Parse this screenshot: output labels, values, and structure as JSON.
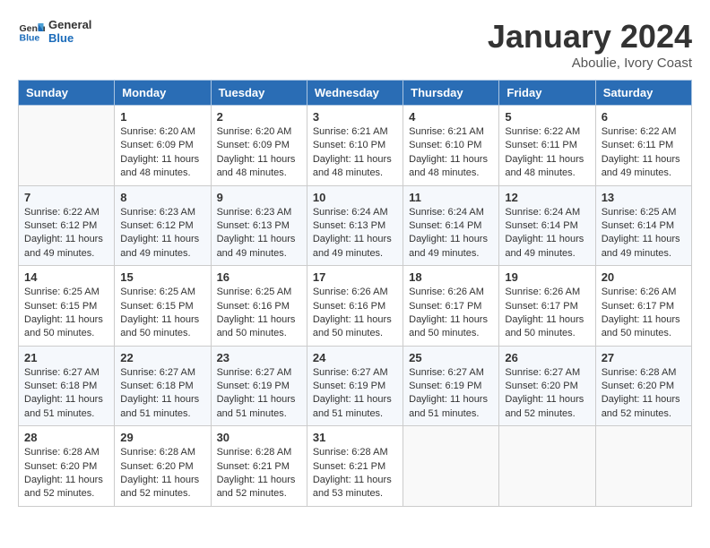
{
  "logo": {
    "line1": "General",
    "line2": "Blue"
  },
  "header": {
    "month": "January 2024",
    "location": "Aboulie, Ivory Coast"
  },
  "days_of_week": [
    "Sunday",
    "Monday",
    "Tuesday",
    "Wednesday",
    "Thursday",
    "Friday",
    "Saturday"
  ],
  "weeks": [
    [
      {
        "day": "",
        "sunrise": "",
        "sunset": "",
        "daylight": ""
      },
      {
        "day": "1",
        "sunrise": "Sunrise: 6:20 AM",
        "sunset": "Sunset: 6:09 PM",
        "daylight": "Daylight: 11 hours and 48 minutes."
      },
      {
        "day": "2",
        "sunrise": "Sunrise: 6:20 AM",
        "sunset": "Sunset: 6:09 PM",
        "daylight": "Daylight: 11 hours and 48 minutes."
      },
      {
        "day": "3",
        "sunrise": "Sunrise: 6:21 AM",
        "sunset": "Sunset: 6:10 PM",
        "daylight": "Daylight: 11 hours and 48 minutes."
      },
      {
        "day": "4",
        "sunrise": "Sunrise: 6:21 AM",
        "sunset": "Sunset: 6:10 PM",
        "daylight": "Daylight: 11 hours and 48 minutes."
      },
      {
        "day": "5",
        "sunrise": "Sunrise: 6:22 AM",
        "sunset": "Sunset: 6:11 PM",
        "daylight": "Daylight: 11 hours and 48 minutes."
      },
      {
        "day": "6",
        "sunrise": "Sunrise: 6:22 AM",
        "sunset": "Sunset: 6:11 PM",
        "daylight": "Daylight: 11 hours and 49 minutes."
      }
    ],
    [
      {
        "day": "7",
        "sunrise": "Sunrise: 6:22 AM",
        "sunset": "Sunset: 6:12 PM",
        "daylight": "Daylight: 11 hours and 49 minutes."
      },
      {
        "day": "8",
        "sunrise": "Sunrise: 6:23 AM",
        "sunset": "Sunset: 6:12 PM",
        "daylight": "Daylight: 11 hours and 49 minutes."
      },
      {
        "day": "9",
        "sunrise": "Sunrise: 6:23 AM",
        "sunset": "Sunset: 6:13 PM",
        "daylight": "Daylight: 11 hours and 49 minutes."
      },
      {
        "day": "10",
        "sunrise": "Sunrise: 6:24 AM",
        "sunset": "Sunset: 6:13 PM",
        "daylight": "Daylight: 11 hours and 49 minutes."
      },
      {
        "day": "11",
        "sunrise": "Sunrise: 6:24 AM",
        "sunset": "Sunset: 6:14 PM",
        "daylight": "Daylight: 11 hours and 49 minutes."
      },
      {
        "day": "12",
        "sunrise": "Sunrise: 6:24 AM",
        "sunset": "Sunset: 6:14 PM",
        "daylight": "Daylight: 11 hours and 49 minutes."
      },
      {
        "day": "13",
        "sunrise": "Sunrise: 6:25 AM",
        "sunset": "Sunset: 6:14 PM",
        "daylight": "Daylight: 11 hours and 49 minutes."
      }
    ],
    [
      {
        "day": "14",
        "sunrise": "Sunrise: 6:25 AM",
        "sunset": "Sunset: 6:15 PM",
        "daylight": "Daylight: 11 hours and 50 minutes."
      },
      {
        "day": "15",
        "sunrise": "Sunrise: 6:25 AM",
        "sunset": "Sunset: 6:15 PM",
        "daylight": "Daylight: 11 hours and 50 minutes."
      },
      {
        "day": "16",
        "sunrise": "Sunrise: 6:25 AM",
        "sunset": "Sunset: 6:16 PM",
        "daylight": "Daylight: 11 hours and 50 minutes."
      },
      {
        "day": "17",
        "sunrise": "Sunrise: 6:26 AM",
        "sunset": "Sunset: 6:16 PM",
        "daylight": "Daylight: 11 hours and 50 minutes."
      },
      {
        "day": "18",
        "sunrise": "Sunrise: 6:26 AM",
        "sunset": "Sunset: 6:17 PM",
        "daylight": "Daylight: 11 hours and 50 minutes."
      },
      {
        "day": "19",
        "sunrise": "Sunrise: 6:26 AM",
        "sunset": "Sunset: 6:17 PM",
        "daylight": "Daylight: 11 hours and 50 minutes."
      },
      {
        "day": "20",
        "sunrise": "Sunrise: 6:26 AM",
        "sunset": "Sunset: 6:17 PM",
        "daylight": "Daylight: 11 hours and 50 minutes."
      }
    ],
    [
      {
        "day": "21",
        "sunrise": "Sunrise: 6:27 AM",
        "sunset": "Sunset: 6:18 PM",
        "daylight": "Daylight: 11 hours and 51 minutes."
      },
      {
        "day": "22",
        "sunrise": "Sunrise: 6:27 AM",
        "sunset": "Sunset: 6:18 PM",
        "daylight": "Daylight: 11 hours and 51 minutes."
      },
      {
        "day": "23",
        "sunrise": "Sunrise: 6:27 AM",
        "sunset": "Sunset: 6:19 PM",
        "daylight": "Daylight: 11 hours and 51 minutes."
      },
      {
        "day": "24",
        "sunrise": "Sunrise: 6:27 AM",
        "sunset": "Sunset: 6:19 PM",
        "daylight": "Daylight: 11 hours and 51 minutes."
      },
      {
        "day": "25",
        "sunrise": "Sunrise: 6:27 AM",
        "sunset": "Sunset: 6:19 PM",
        "daylight": "Daylight: 11 hours and 51 minutes."
      },
      {
        "day": "26",
        "sunrise": "Sunrise: 6:27 AM",
        "sunset": "Sunset: 6:20 PM",
        "daylight": "Daylight: 11 hours and 52 minutes."
      },
      {
        "day": "27",
        "sunrise": "Sunrise: 6:28 AM",
        "sunset": "Sunset: 6:20 PM",
        "daylight": "Daylight: 11 hours and 52 minutes."
      }
    ],
    [
      {
        "day": "28",
        "sunrise": "Sunrise: 6:28 AM",
        "sunset": "Sunset: 6:20 PM",
        "daylight": "Daylight: 11 hours and 52 minutes."
      },
      {
        "day": "29",
        "sunrise": "Sunrise: 6:28 AM",
        "sunset": "Sunset: 6:20 PM",
        "daylight": "Daylight: 11 hours and 52 minutes."
      },
      {
        "day": "30",
        "sunrise": "Sunrise: 6:28 AM",
        "sunset": "Sunset: 6:21 PM",
        "daylight": "Daylight: 11 hours and 52 minutes."
      },
      {
        "day": "31",
        "sunrise": "Sunrise: 6:28 AM",
        "sunset": "Sunset: 6:21 PM",
        "daylight": "Daylight: 11 hours and 53 minutes."
      },
      {
        "day": "",
        "sunrise": "",
        "sunset": "",
        "daylight": ""
      },
      {
        "day": "",
        "sunrise": "",
        "sunset": "",
        "daylight": ""
      },
      {
        "day": "",
        "sunrise": "",
        "sunset": "",
        "daylight": ""
      }
    ]
  ]
}
